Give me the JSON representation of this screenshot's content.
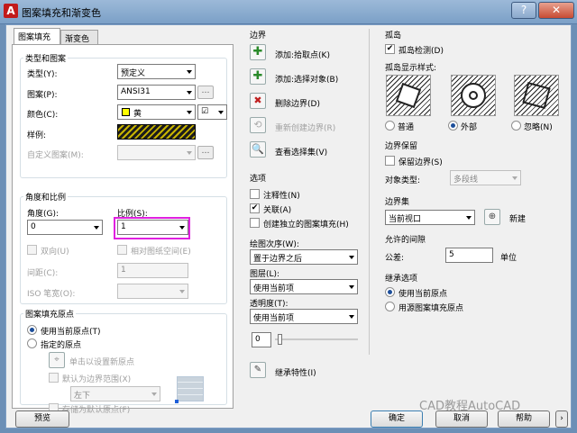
{
  "title": "图案填充和渐变色",
  "tabs": [
    "图案填充",
    "渐变色"
  ],
  "type_pattern": {
    "group": "类型和图案",
    "type_label": "类型(Y):",
    "type_value": "预定义",
    "pattern_label": "图案(P):",
    "pattern_value": "ANSI31",
    "color_label": "颜色(C):",
    "color_value": "黄",
    "color_hex": "#ffff00",
    "bg_value": "☑",
    "swatch_label": "样例:",
    "custom_label": "自定义图案(M):"
  },
  "angle_scale": {
    "group": "角度和比例",
    "angle_label": "角度(G):",
    "angle_value": "0",
    "scale_label": "比例(S):",
    "scale_value": "1",
    "double_label": "双向(U)",
    "relative_label": "相对图纸空间(E)",
    "spacing_label": "间距(C):",
    "spacing_value": "1",
    "iso_label": "ISO 笔宽(O):"
  },
  "origin": {
    "group": "图案填充原点",
    "current_label": "使用当前原点(T)",
    "specified_label": "指定的原点",
    "click_label": "单击以设置新原点",
    "default_extents_label": "默认为边界范围(X)",
    "position_value": "左下",
    "store_label": "存储为默认原点(F)"
  },
  "boundaries": {
    "header": "边界",
    "add_pick": "添加:拾取点(K)",
    "add_select": "添加:选择对象(B)",
    "remove": "删除边界(D)",
    "recreate": "重新创建边界(R)",
    "view_select": "查看选择集(V)"
  },
  "options": {
    "header": "选项",
    "annotative": "注释性(N)",
    "associative": "关联(A)",
    "separate": "创建独立的图案填充(H)",
    "draw_order_label": "绘图次序(W):",
    "draw_order_value": "置于边界之后",
    "layer_label": "图层(L):",
    "layer_value": "使用当前项",
    "transparency_label": "透明度(T):",
    "transparency_value": "使用当前项",
    "transparency_num": "0",
    "inherit": "继承特性(I)"
  },
  "islands": {
    "header": "孤岛",
    "detect": "孤岛检测(D)",
    "style_label": "孤岛显示样式:",
    "styles": [
      "普通",
      "外部",
      "忽略(N)"
    ]
  },
  "retention": {
    "header": "边界保留",
    "retain": "保留边界(S)",
    "object_type_label": "对象类型:",
    "object_type_value": "多段线"
  },
  "boundary_set": {
    "header": "边界集",
    "value": "当前视口",
    "new_label": "新建"
  },
  "gap": {
    "header": "允许的间隙",
    "tolerance_label": "公差:",
    "tolerance_value": "5",
    "unit_label": "单位"
  },
  "inherit_opts": {
    "header": "继承选项",
    "current": "使用当前原点",
    "source": "用源图案填充原点"
  },
  "footer": {
    "preview": "预览",
    "ok": "确定",
    "cancel": "取消",
    "help": "帮助"
  },
  "watermark": "CAD教程AutoCAD"
}
